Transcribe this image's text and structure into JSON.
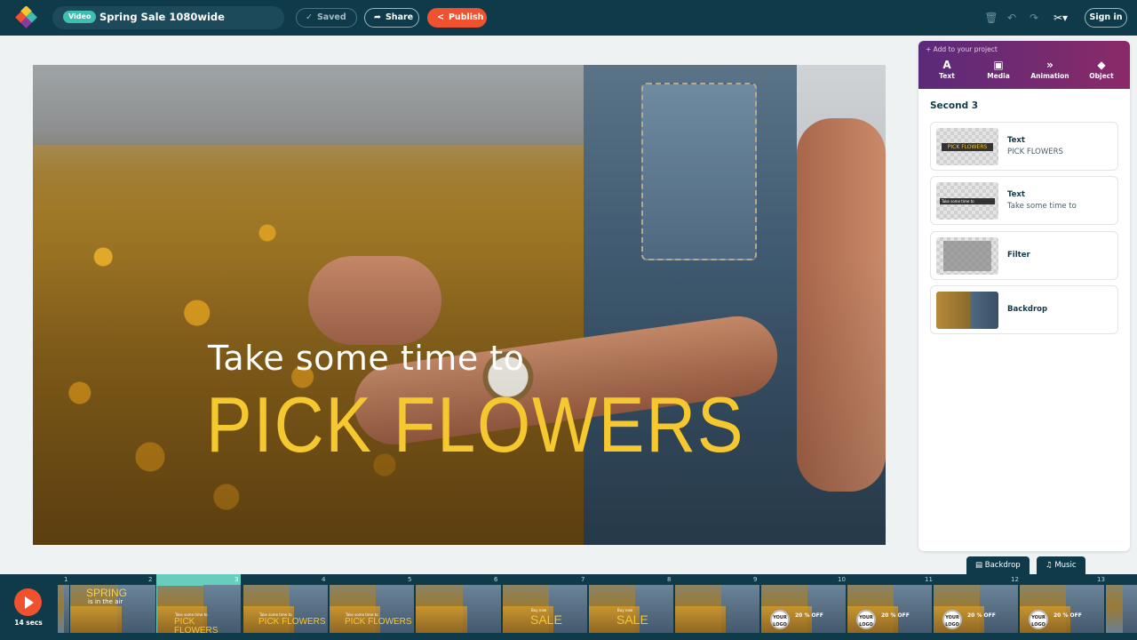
{
  "header": {
    "badge": "Video",
    "title": "Spring Sale 1080wide",
    "saved_label": "Saved",
    "share_label": "Share",
    "publish_label": "Publish",
    "signin_label": "Sign in",
    "icons": [
      "trash-icon",
      "undo-icon",
      "redo-icon",
      "tools-icon"
    ]
  },
  "canvas": {
    "line1": "Take some time to",
    "line2": "PICK FLOWERS"
  },
  "panel": {
    "add_label": "+ Add to your project",
    "tabs": [
      {
        "icon": "A",
        "label": "Text"
      },
      {
        "icon": "▣",
        "label": "Media"
      },
      {
        "icon": "»",
        "label": "Animation"
      },
      {
        "icon": "◆",
        "label": "Object"
      }
    ],
    "section": "Second 3",
    "layers": [
      {
        "type": "Text",
        "sub": "PICK FLOWERS",
        "thumb_text": "PICK FLOWERS"
      },
      {
        "type": "Text",
        "sub": "Take some time to",
        "thumb_text": "Take some time to"
      },
      {
        "type": "Filter",
        "sub": ""
      },
      {
        "type": "Backdrop",
        "sub": ""
      }
    ]
  },
  "timeline": {
    "backdrop_label": "Backdrop",
    "music_label": "Music",
    "duration": "14 secs",
    "frame_numbers": [
      "1",
      "2",
      "3",
      "4",
      "5",
      "6",
      "7",
      "8",
      "9",
      "10",
      "11",
      "12",
      "13"
    ],
    "frames": [
      {
        "big": "SPRING",
        "small": "is in the air"
      },
      {
        "big": "PICK FLOWERS",
        "small": "Take some time to"
      },
      {
        "big": "PICK FLOWERS",
        "small": "Take some time to"
      },
      {
        "big": "PICK FLOWERS",
        "small": "Take some time to"
      },
      {
        "big": "",
        "small": ""
      },
      {
        "big": "SALE",
        "small": "Buy now"
      },
      {
        "big": "SALE",
        "small": "Buy now"
      },
      {
        "big": "",
        "small": ""
      },
      {
        "big": "20 % OFF",
        "small": "YOUR LOGO"
      },
      {
        "big": "20 % OFF",
        "small": "YOUR LOGO"
      },
      {
        "big": "20 % OFF",
        "small": "YOUR LOGO"
      },
      {
        "big": "20 % OFF",
        "small": "YOUR LOGO"
      },
      {
        "big": "",
        "small": ""
      }
    ]
  },
  "colors": {
    "navy": "#0f3a4a",
    "accent_orange": "#f0512f",
    "teal": "#67cdbd",
    "headline_yellow": "#f6c830",
    "panel_gradient_start": "#5a2a7a",
    "panel_gradient_end": "#8a2a68"
  }
}
